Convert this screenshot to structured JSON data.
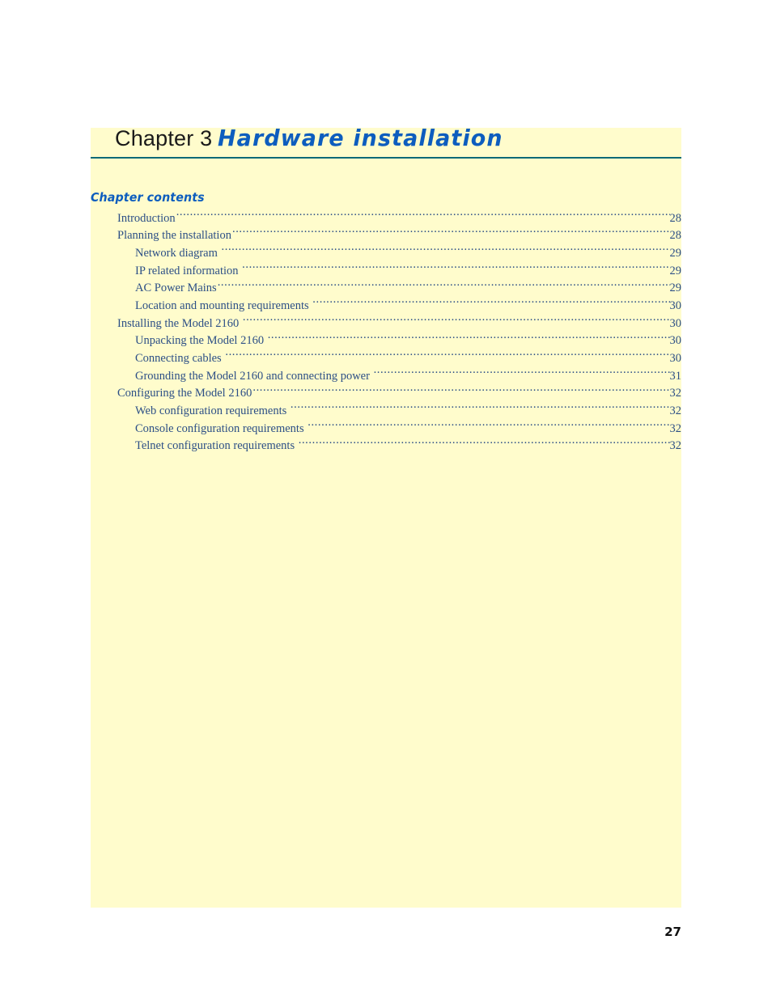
{
  "document": {
    "folio": "27"
  },
  "chapter": {
    "number_label": "Chapter 3",
    "title": "Hardware installation",
    "contents_heading": "Chapter contents",
    "accent_blue": "#0d5dbe",
    "toc_text_color": "#2c4f86",
    "panel_background": "#fffccc",
    "rule_color": "#0b6a77"
  },
  "toc": {
    "entries": [
      {
        "label": "Introduction",
        "page": "28",
        "level": 1,
        "leader_gap": false
      },
      {
        "label": "Planning the installation",
        "page": "28",
        "level": 1,
        "leader_gap": false
      },
      {
        "label": "Network diagram",
        "page": "29",
        "level": 2,
        "leader_gap": true
      },
      {
        "label": "IP related information",
        "page": "29",
        "level": 2,
        "leader_gap": true
      },
      {
        "label": "AC Power Mains",
        "page": "29",
        "level": 2,
        "leader_gap": false
      },
      {
        "label": "Location and mounting requirements",
        "page": "30",
        "level": 2,
        "leader_gap": true
      },
      {
        "label": "Installing the Model 2160",
        "page": "30",
        "level": 1,
        "leader_gap": true
      },
      {
        "label": "Unpacking the Model 2160",
        "page": "30",
        "level": 2,
        "leader_gap": true
      },
      {
        "label": "Connecting cables",
        "page": "30",
        "level": 2,
        "leader_gap": true
      },
      {
        "label": "Grounding the Model 2160 and connecting power",
        "page": "31",
        "level": 2,
        "leader_gap": true
      },
      {
        "label": "Configuring the Model 2160",
        "page": "32",
        "level": 1,
        "leader_gap": false
      },
      {
        "label": "Web configuration requirements",
        "page": "32",
        "level": 2,
        "leader_gap": true
      },
      {
        "label": "Console configuration requirements",
        "page": "32",
        "level": 2,
        "leader_gap": true
      },
      {
        "label": "Telnet configuration requirements",
        "page": "32",
        "level": 2,
        "leader_gap": true
      }
    ]
  }
}
